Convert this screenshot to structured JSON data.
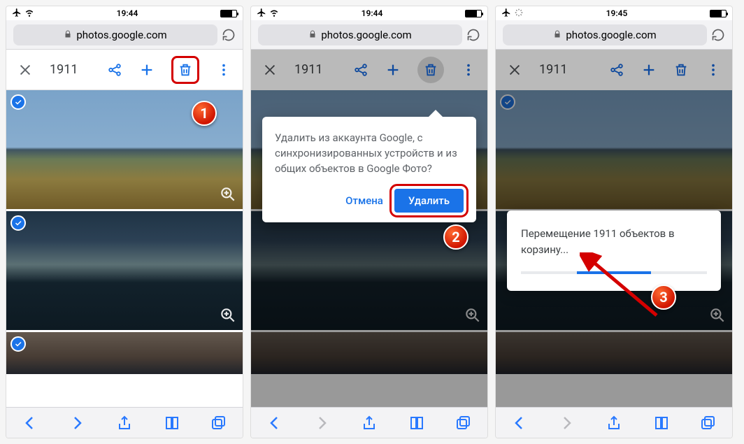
{
  "status": {
    "time1": "19:44",
    "time2": "19:44",
    "time3": "19:45"
  },
  "url": "photos.google.com",
  "selection_count": "1911",
  "popup": {
    "text": "Удалить из аккаунта Google, с синхронизированных устройств и из общих объектов в Google Фото?",
    "cancel": "Отмена",
    "delete": "Удалить"
  },
  "progress": {
    "text": "Перемещение 1911 объектов в корзину..."
  },
  "callouts": {
    "c1": "1",
    "c2": "2",
    "c3": "3"
  }
}
